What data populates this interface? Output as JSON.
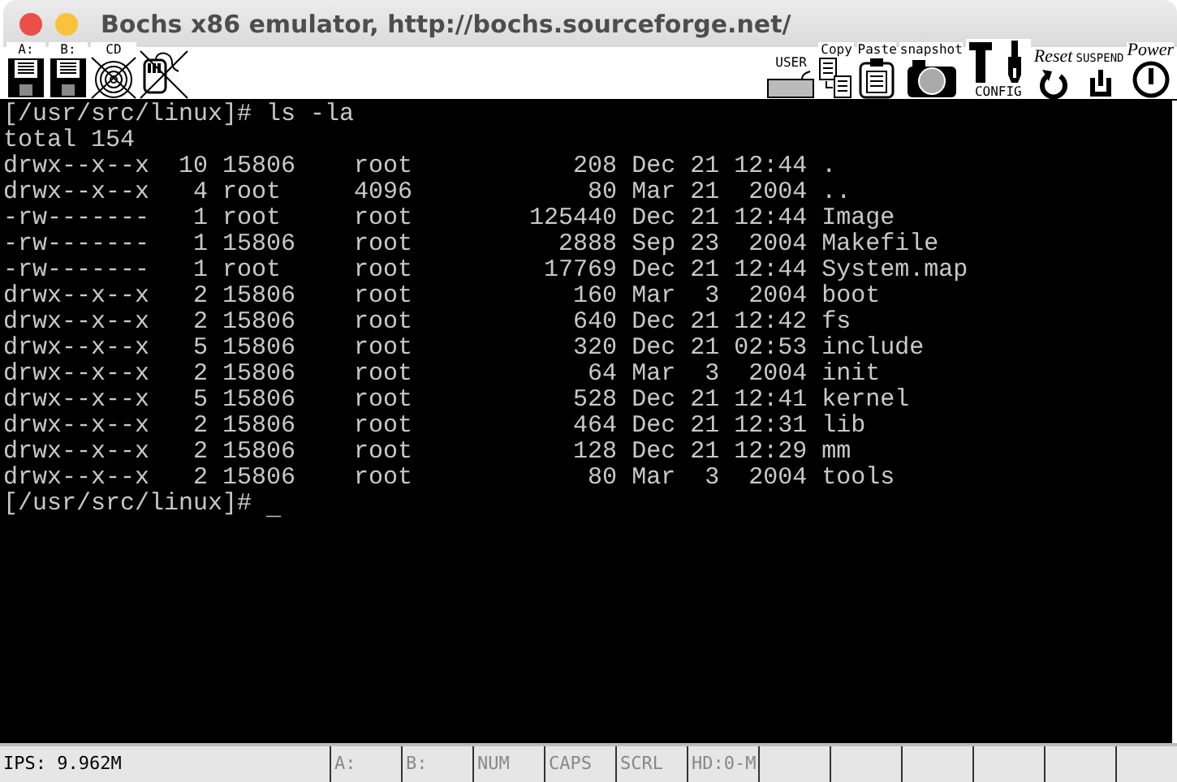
{
  "window": {
    "title": "Bochs x86 emulator, http://bochs.sourceforge.net/"
  },
  "toolbar_left": [
    {
      "label": "A:",
      "kind": "floppy",
      "disabled": false
    },
    {
      "label": "B:",
      "kind": "floppy",
      "disabled": false
    },
    {
      "label": "CD",
      "kind": "cdrom",
      "disabled": true
    },
    {
      "kind": "mouse",
      "disabled": true
    }
  ],
  "toolbar_right": [
    {
      "label": "USER",
      "kind": "keyboard"
    },
    {
      "label": "Copy",
      "kind": "copy"
    },
    {
      "label": "Paste",
      "kind": "paste"
    },
    {
      "label": "snapshot",
      "kind": "camera"
    },
    {
      "label": "CONFIG",
      "kind": "config"
    },
    {
      "label": "Reset",
      "kind": "reset"
    },
    {
      "label": "SUSPEND",
      "kind": "suspend"
    },
    {
      "label": "Power",
      "kind": "power"
    }
  ],
  "terminal": {
    "lines": [
      "[/usr/src/linux]# ls -la",
      "total 154",
      "drwx--x--x  10 15806    root           208 Dec 21 12:44 .",
      "drwx--x--x   4 root     4096            80 Mar 21  2004 ..",
      "-rw-------   1 root     root        125440 Dec 21 12:44 Image",
      "-rw-------   1 15806    root          2888 Sep 23  2004 Makefile",
      "-rw-------   1 root     root         17769 Dec 21 12:44 System.map",
      "drwx--x--x   2 15806    root           160 Mar  3  2004 boot",
      "drwx--x--x   2 15806    root           640 Dec 21 12:42 fs",
      "drwx--x--x   5 15806    root           320 Dec 21 02:53 include",
      "drwx--x--x   2 15806    root            64 Mar  3  2004 init",
      "drwx--x--x   5 15806    root           528 Dec 21 12:41 kernel",
      "drwx--x--x   2 15806    root           464 Dec 21 12:31 lib",
      "drwx--x--x   2 15806    root           128 Dec 21 12:29 mm",
      "drwx--x--x   2 15806    root            80 Mar  3  2004 tools"
    ],
    "prompt": "[/usr/src/linux]# ",
    "cursor": "_"
  },
  "status_bar": [
    {
      "text": "IPS: 9.962M",
      "active": true
    },
    {
      "text": "A:",
      "active": false
    },
    {
      "text": "B:",
      "active": false
    },
    {
      "text": "NUM",
      "active": false
    },
    {
      "text": "CAPS",
      "active": false
    },
    {
      "text": "SCRL",
      "active": false
    },
    {
      "text": "HD:0-M",
      "active": false
    }
  ]
}
